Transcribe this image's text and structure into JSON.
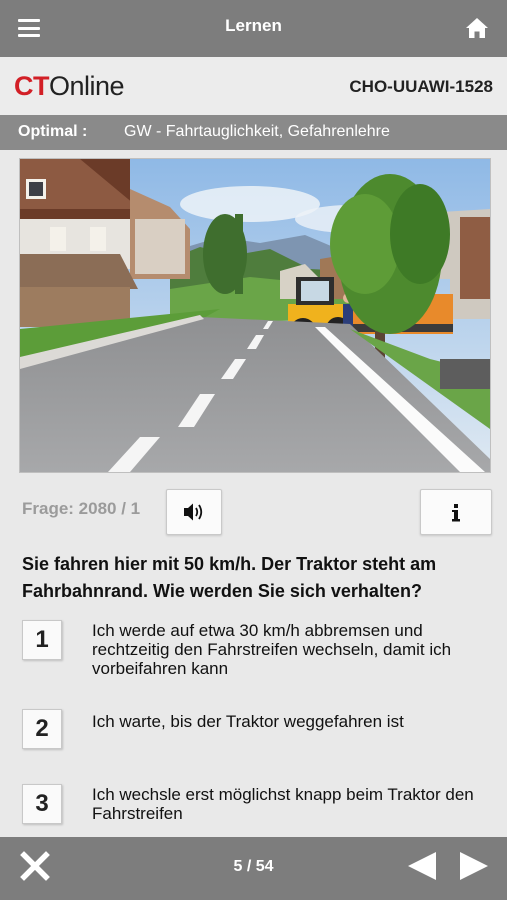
{
  "header": {
    "title": "Lernen",
    "menu_icon": "hamburger-menu-icon",
    "home_icon": "home-icon"
  },
  "brand": {
    "logo_ct": "CT",
    "logo_online": "Online",
    "code": "CHO-UUAWI-1528",
    "logo_red": "#d21f26"
  },
  "category": {
    "label": "Optimal :",
    "text": "GW - Fahrtauglichkeit, Gefahrenlehre"
  },
  "question": {
    "counter": "Frage: 2080 / 1",
    "text": "Sie fahren hier mit 50 km/h. Der Traktor steht am Fahrbahnrand. Wie werden Sie sich verhalten?",
    "sound_icon": "speaker-icon",
    "info_icon": "info-icon"
  },
  "answers": [
    {
      "number": "1",
      "text": "Ich werde auf etwa 30 km/h abbremsen und rechtzeitig den Fahrstreifen wechseln, damit ich vorbeifahren kann"
    },
    {
      "number": "2",
      "text": "Ich warte, bis der Traktor weggefahren ist"
    },
    {
      "number": "3",
      "text": "Ich wechsle erst möglichst knapp beim Traktor den Fahrstreifen"
    }
  ],
  "footer": {
    "page": "5 / 54",
    "close_icon": "close-icon",
    "prev_icon": "previous-triangle-icon",
    "next_icon": "next-triangle-icon"
  },
  "colors": {
    "bar": "#7d7d7d",
    "category_bar": "#8a8a8a",
    "background": "#e9e9e9"
  }
}
